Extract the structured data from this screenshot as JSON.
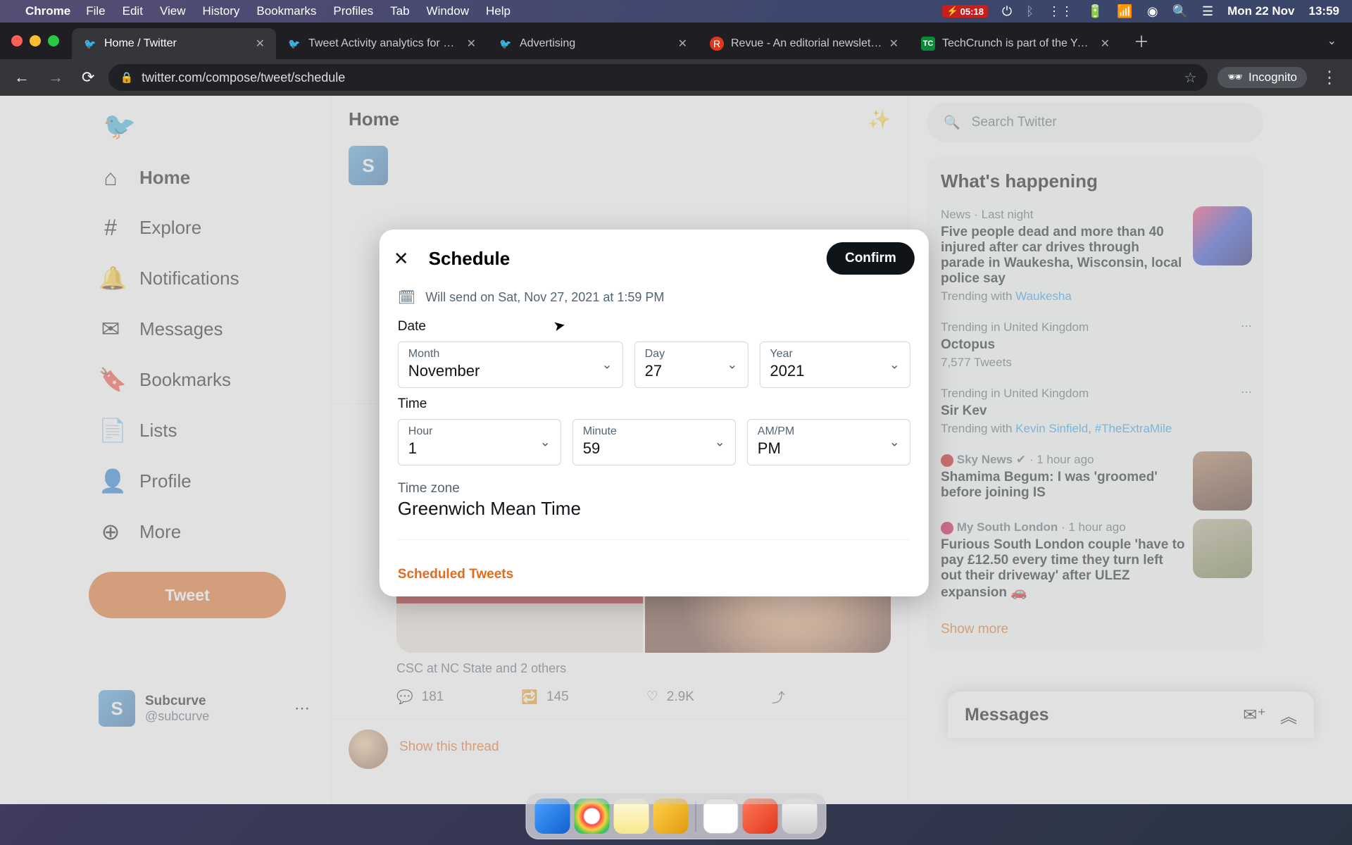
{
  "menubar": {
    "app": "Chrome",
    "items": [
      "File",
      "Edit",
      "View",
      "History",
      "Bookmarks",
      "Profiles",
      "Tab",
      "Window",
      "Help"
    ],
    "battery": "05:18",
    "date": "Mon 22 Nov",
    "time": "13:59"
  },
  "tabs": [
    {
      "title": "Home / Twitter",
      "icon": "twitter",
      "active": true
    },
    {
      "title": "Tweet Activity analytics for sub",
      "icon": "twitter",
      "active": false
    },
    {
      "title": "Advertising",
      "icon": "twitter",
      "active": false
    },
    {
      "title": "Revue - An editorial newsletter",
      "icon": "revue",
      "active": false
    },
    {
      "title": "TechCrunch is part of the Yaho",
      "icon": "tc",
      "active": false
    }
  ],
  "addressbar": {
    "url": "twitter.com/compose/tweet/schedule",
    "incognito_label": "Incognito"
  },
  "sidebar": {
    "items": [
      {
        "icon": "home",
        "label": "Home",
        "bold": true
      },
      {
        "icon": "hash",
        "label": "Explore"
      },
      {
        "icon": "bell",
        "label": "Notifications"
      },
      {
        "icon": "mail",
        "label": "Messages"
      },
      {
        "icon": "bookmark",
        "label": "Bookmarks"
      },
      {
        "icon": "list",
        "label": "Lists"
      },
      {
        "icon": "person",
        "label": "Profile"
      },
      {
        "icon": "more",
        "label": "More"
      }
    ],
    "tweet_button": "Tweet",
    "account": {
      "name": "Subcurve",
      "handle": "@subcurve",
      "initial": "S"
    }
  },
  "main": {
    "home_title": "Home",
    "compose_initial": "S",
    "feed_caption": "CSC at NC State and 2 others",
    "actions": {
      "reply": "181",
      "retweet": "145",
      "like": "2.9K"
    },
    "show_thread": "Show this thread"
  },
  "right": {
    "search_placeholder": "Search Twitter",
    "heading": "What's happening",
    "trends": [
      {
        "meta": "News · Last night",
        "title": "Five people dead and more than 40 injured after car drives through parade in Waukesha, Wisconsin, local police say",
        "sub_prefix": "Trending with",
        "sub_link": "Waukesha",
        "thumb": "thumb1"
      },
      {
        "meta": "Trending in United Kingdom",
        "title": "Octopus",
        "sub_prefix": "",
        "sub": "7,577 Tweets",
        "thumb": ""
      },
      {
        "meta": "Trending in United Kingdom",
        "title": "Sir Kev",
        "sub_prefix": "Trending with",
        "sub_link": "Kevin Sinfield",
        "sub_link2": "#TheExtraMile",
        "thumb": ""
      },
      {
        "meta_source": "Sky News",
        "meta_verified": true,
        "meta_time": "1 hour ago",
        "title": "Shamima Begum: I was 'groomed' before joining IS",
        "thumb": "thumb2"
      },
      {
        "meta_source": "My South London",
        "meta_time": "1 hour ago",
        "title": "Furious South London couple 'have to pay £12.50 every time they turn left out their driveway' after ULEZ expansion 🚗",
        "thumb": "thumb3"
      }
    ],
    "show_more": "Show more"
  },
  "messages_bar": {
    "title": "Messages"
  },
  "modal": {
    "title": "Schedule",
    "confirm": "Confirm",
    "will_send": "Will send on Sat, Nov 27, 2021 at 1:59 PM",
    "date_label": "Date",
    "time_label": "Time",
    "fields": {
      "month": {
        "label": "Month",
        "value": "November"
      },
      "day": {
        "label": "Day",
        "value": "27"
      },
      "year": {
        "label": "Year",
        "value": "2021"
      },
      "hour": {
        "label": "Hour",
        "value": "1"
      },
      "minute": {
        "label": "Minute",
        "value": "59"
      },
      "ampm": {
        "label": "AM/PM",
        "value": "PM"
      }
    },
    "tz_label": "Time zone",
    "tz_value": "Greenwich Mean Time",
    "scheduled_link": "Scheduled Tweets"
  }
}
